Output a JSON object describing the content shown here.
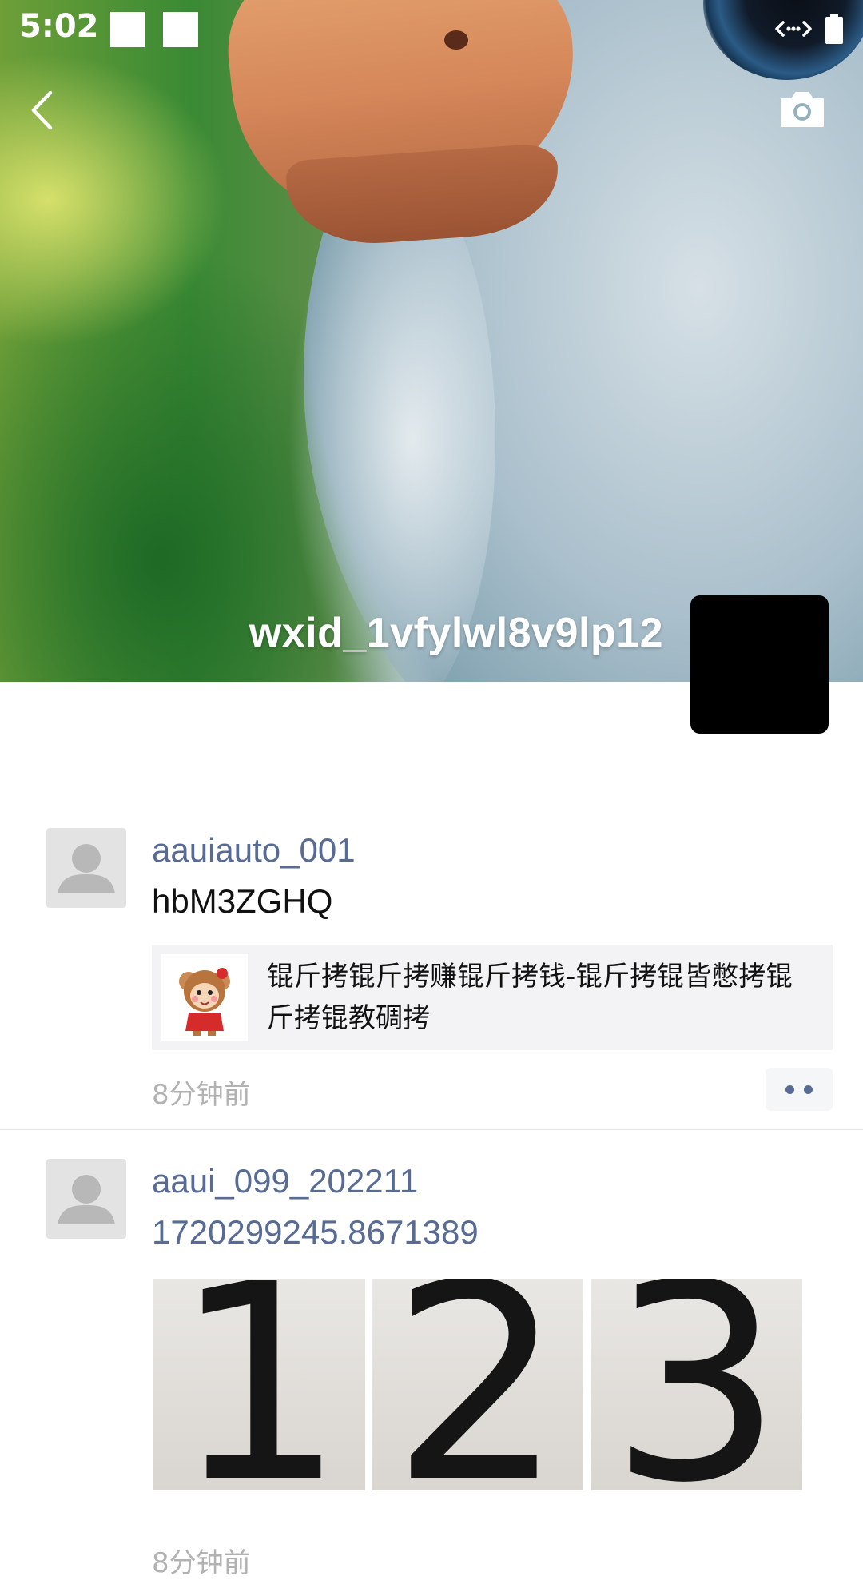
{
  "status_bar": {
    "time": "5:02",
    "icons": [
      "notification-square",
      "notification-square",
      "data-transfer-icon",
      "battery-icon"
    ]
  },
  "header": {
    "back_icon": "chevron-left-icon",
    "camera_icon": "camera-icon"
  },
  "cover": {
    "username": "wxid_1vfylwl8v9lp12"
  },
  "posts": [
    {
      "author": "aauiauto_001",
      "text": "hbM3ZGHQ",
      "link": {
        "title": "锟斤拷锟斤拷赚锟斤拷钱-锟斤拷锟皆憋拷锟斤拷锟教碉拷"
      },
      "time": "8分钟前"
    },
    {
      "author": "aaui_099_202211",
      "text": "1720299245.8671389",
      "photos": [
        "1",
        "2",
        "3"
      ],
      "time": "8分钟前"
    }
  ],
  "colors": {
    "link_blue": "#576b95",
    "time_gray": "#b2b2b2",
    "card_bg": "#f3f3f5"
  }
}
